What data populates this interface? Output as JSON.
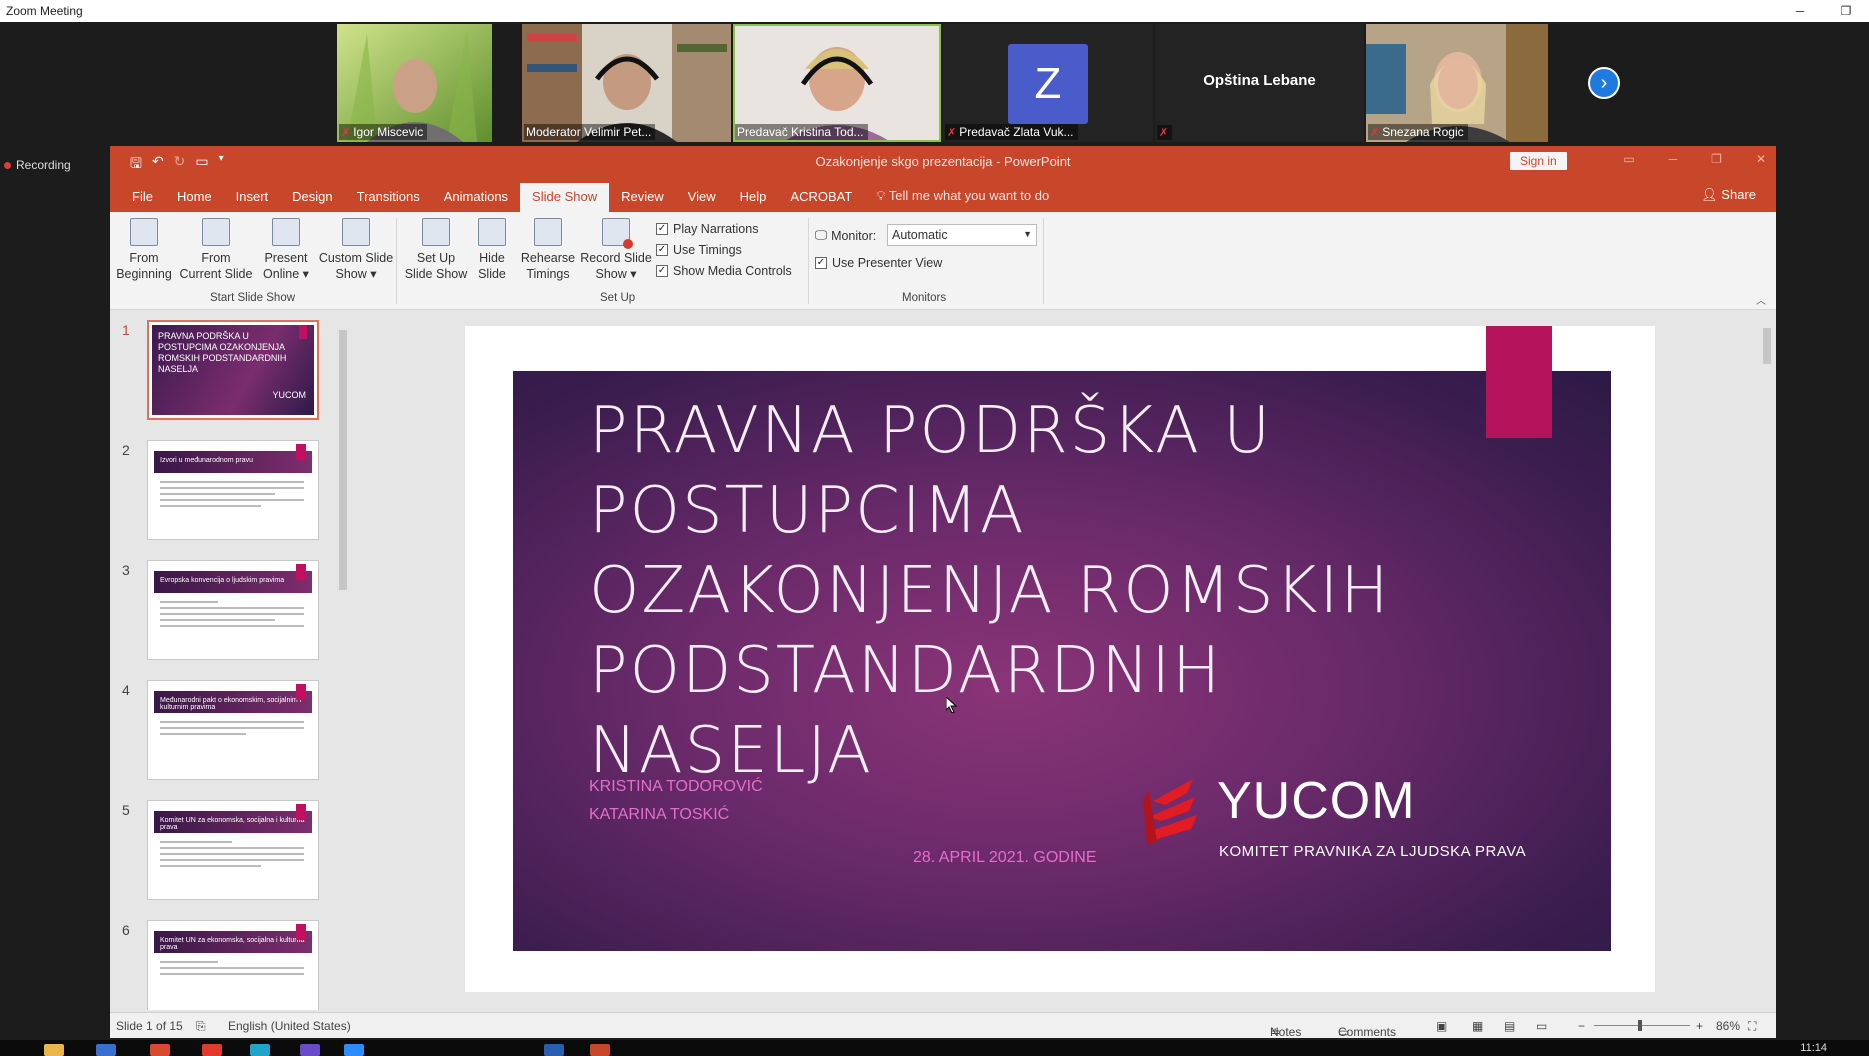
{
  "zoom": {
    "window_title": "Zoom Meeting",
    "recording_label": "Recording",
    "participants": [
      {
        "name": "Igor Miscevic",
        "muted": true
      },
      {
        "name": "Moderator Velimir Pet...",
        "muted": false
      },
      {
        "name": "Predavač Kristina Tod...",
        "muted": false,
        "active": true
      },
      {
        "name": "Predavač Zlata Vuk...",
        "muted": true,
        "avatar_letter": "Z"
      },
      {
        "name": "Opština Lebane",
        "muted": true
      },
      {
        "name": "Snezana Rogic",
        "muted": true
      }
    ]
  },
  "powerpoint": {
    "title": "Ozakonjenje skgo prezentacija  -  PowerPoint",
    "sign_in": "Sign in",
    "share": "Share",
    "tabs": [
      "File",
      "Home",
      "Insert",
      "Design",
      "Transitions",
      "Animations",
      "Slide Show",
      "Review",
      "View",
      "Help",
      "ACROBAT"
    ],
    "active_tab": "Slide Show",
    "tell_me": "Tell me what you want to do",
    "ribbon": {
      "from_beginning": [
        "From",
        "Beginning"
      ],
      "from_current": [
        "From",
        "Current Slide"
      ],
      "present_online": [
        "Present",
        "Online ▾"
      ],
      "custom_show": [
        "Custom Slide",
        "Show ▾"
      ],
      "group_start": "Start Slide Show",
      "setup_show": [
        "Set Up",
        "Slide Show"
      ],
      "hide_slide": [
        "Hide",
        "Slide"
      ],
      "rehearse": [
        "Rehearse",
        "Timings"
      ],
      "record": [
        "Record Slide",
        "Show ▾"
      ],
      "play_narrations": "Play Narrations",
      "use_timings": "Use Timings",
      "show_media_controls": "Show Media Controls",
      "group_setup": "Set Up",
      "monitor_label": "Monitor:",
      "monitor_value": "Automatic",
      "use_presenter_view": "Use Presenter View",
      "group_monitors": "Monitors"
    },
    "thumbnails": [
      {
        "num": "1",
        "title": "PRAVNA PODRŠKA U POSTUPCIMA OZAKONJENJA ROMSKIH PODSTANDARDNIH NASELJA",
        "logo": "YUCOM"
      },
      {
        "num": "2",
        "title": "Izvori u međunarodnom pravu"
      },
      {
        "num": "3",
        "title": "Evropska konvencija o ljudskim pravima"
      },
      {
        "num": "4",
        "title": "Međunarodni pakt o ekonomskim, socijalnim i kulturnim pravima"
      },
      {
        "num": "5",
        "title": "Komitet UN za ekonomska, socijalna i kulturna prava"
      },
      {
        "num": "6",
        "title": "Komitet UN za ekonomska, socijalna i kulturna prava"
      }
    ],
    "slide": {
      "title_lines": [
        "PRAVNA PODRŠKA U",
        "POSTUPCIMA",
        "OZAKONJENJA ROMSKIH",
        "PODSTANDARDNIH",
        "NASELJA"
      ],
      "authors": [
        "KRISTINA TODOROVIĆ",
        "KATARINA TOSKIĆ"
      ],
      "date": "28. APRIL 2021. GODINE",
      "logo_name": "YUCOM",
      "logo_sub": "KOMITET PRAVNIKA ZA LJUDSKA PRAVA"
    },
    "status": {
      "slide_of": "Slide 1 of 15",
      "language": "English (United States)",
      "notes": "Notes",
      "comments": "Comments",
      "zoom": "86%"
    }
  },
  "taskbar": {
    "time": "11:14"
  }
}
